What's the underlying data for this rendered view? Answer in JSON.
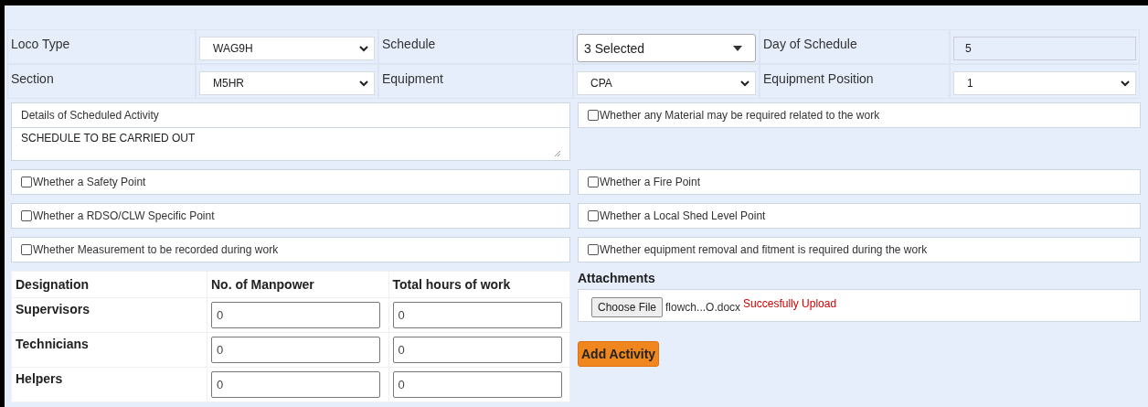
{
  "fields": [
    {
      "label": "Loco Type",
      "kind": "select",
      "value": "WAG9H"
    },
    {
      "label": "Schedule",
      "kind": "multiselect",
      "value": "3 Selected"
    },
    {
      "label": "Day of Schedule",
      "kind": "readonly",
      "value": "5"
    },
    {
      "label": "Section",
      "kind": "select",
      "value": "M5HR"
    },
    {
      "label": "Equipment",
      "kind": "select",
      "value": "CPA"
    },
    {
      "label": "Equipment Position",
      "kind": "select",
      "value": "1"
    }
  ],
  "details": {
    "label": "Details of Scheduled Activity",
    "value": "SCHEDULE TO BE CARRIED OUT"
  },
  "material_check": {
    "label": "Whether any Material may be required related to the work",
    "checked": false
  },
  "check_rows": [
    [
      {
        "label": "Whether a Safety Point",
        "checked": false
      },
      {
        "label": "Whether a Fire Point",
        "checked": false
      }
    ],
    [
      {
        "label": "Whether a RDSO/CLW Specific Point",
        "checked": false
      },
      {
        "label": "Whether a Local Shed Level Point",
        "checked": false
      }
    ],
    [
      {
        "label": "Whether Measurement to be recorded during work",
        "checked": false
      },
      {
        "label": "Whether equipment removal and fitment is required during the work",
        "checked": false
      }
    ]
  ],
  "manpower": {
    "columns": [
      "Designation",
      "No. of Manpower",
      "Total hours of work"
    ],
    "rows": [
      {
        "designation": "Supervisors",
        "manpower": "0",
        "hours": "0"
      },
      {
        "designation": "Technicians",
        "manpower": "0",
        "hours": "0"
      },
      {
        "designation": "Helpers",
        "manpower": "0",
        "hours": "0"
      }
    ]
  },
  "attachments": {
    "title": "Attachments",
    "choose_button": "Choose File",
    "file_name": "flowch...O.docx",
    "status": "Succesfully Upload",
    "add_button": "Add Activity"
  }
}
